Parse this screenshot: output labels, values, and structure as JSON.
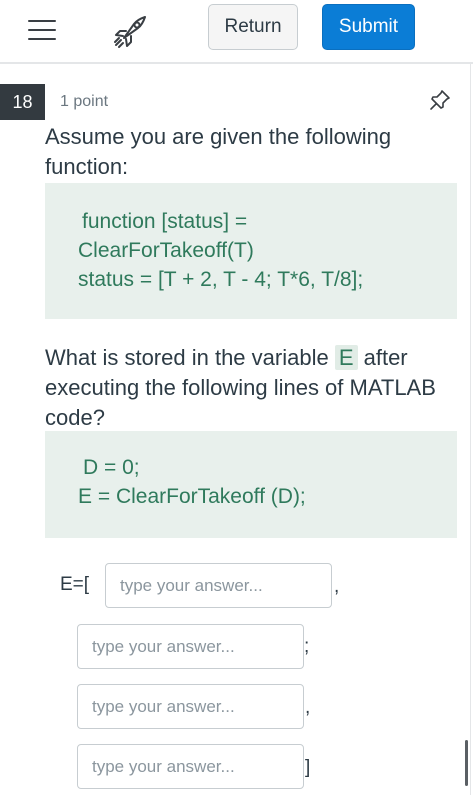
{
  "toolbar": {
    "return_label": "Return",
    "submit_label": "Submit",
    "menu_icon": "hamburger-icon",
    "rocket_icon": "rocket-icon",
    "submit_color": "#0b7dd6"
  },
  "question": {
    "number": "18",
    "points": "1 point",
    "pin_icon": "pin-icon",
    "prompt_1": "Assume you are given the following function:",
    "code_1": {
      "line1": "function [status] =",
      "line2": "ClearForTakeoff(T)",
      "line3": "status = [T + 2, T - 4; T*6, T/8];"
    },
    "prompt_2_before": "What is stored in the variable ",
    "prompt_2_var": "E",
    "prompt_2_after": " after executing the following lines of MATLAB code?",
    "code_2": {
      "line1": "D = 0;",
      "line2": "E = ClearForTakeoff (D);"
    }
  },
  "answer": {
    "prefix": "E=[",
    "sep_1": ",",
    "sep_2": ";",
    "sep_3": ",",
    "suffix": "]",
    "fields": [
      {
        "value": "",
        "placeholder": "type your answer..."
      },
      {
        "value": "",
        "placeholder": "type your answer..."
      },
      {
        "value": "",
        "placeholder": "type your answer..."
      },
      {
        "value": "",
        "placeholder": "type your answer..."
      }
    ]
  }
}
